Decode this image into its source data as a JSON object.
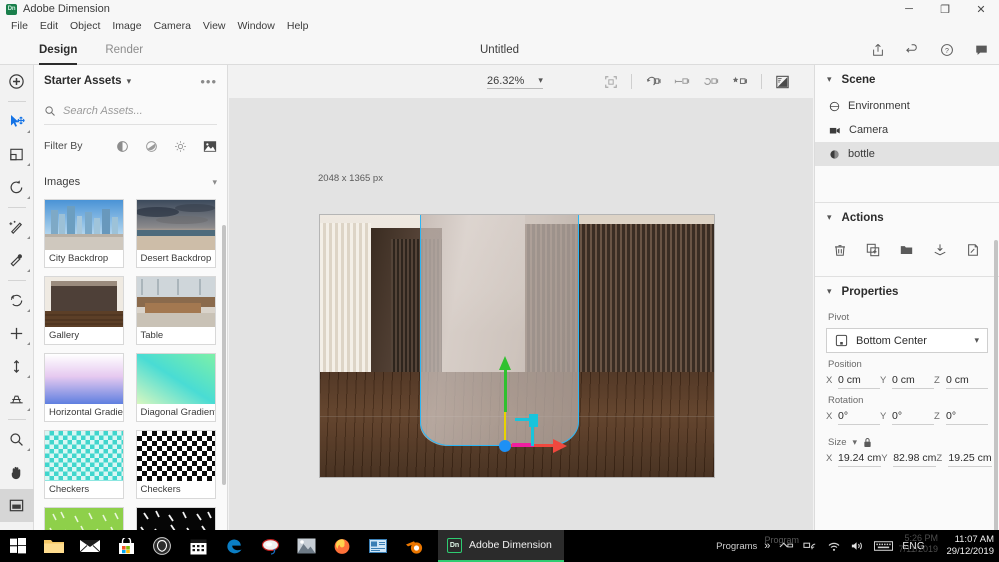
{
  "window": {
    "app_name": "Adobe Dimension",
    "app_badge": "Dn",
    "minimize": "─",
    "maximize": "❐",
    "close": "✕"
  },
  "menubar": {
    "items": [
      "File",
      "Edit",
      "Object",
      "Image",
      "Camera",
      "View",
      "Window",
      "Help"
    ]
  },
  "docbar": {
    "tabs": [
      {
        "label": "Design",
        "active": true
      },
      {
        "label": "Render",
        "active": false
      }
    ],
    "document_title": "Untitled",
    "actions": [
      "share-icon",
      "undo-icon",
      "help-icon",
      "comment-icon"
    ]
  },
  "toolrail": {
    "tools": [
      {
        "name": "add-content-icon",
        "selected": false
      },
      {
        "name": "select-move-icon",
        "selected": false
      },
      {
        "name": "magic-wand-place-icon",
        "selected": false
      },
      {
        "name": "rotate-icon",
        "selected": false
      },
      {
        "name": "material-picker-icon",
        "selected": false
      },
      {
        "name": "sampler-eyedropper-icon",
        "selected": false
      },
      {
        "name": "orbit-icon",
        "selected": false
      },
      {
        "name": "pan-move-icon",
        "selected": false
      },
      {
        "name": "dolly-icon",
        "selected": false
      },
      {
        "name": "horizon-icon",
        "selected": false
      },
      {
        "name": "zoom-icon",
        "selected": false
      },
      {
        "name": "hand-icon",
        "selected": false
      },
      {
        "name": "render-preview-icon",
        "selected": true
      }
    ]
  },
  "assets_panel": {
    "title": "Starter Assets",
    "overflow_label": "•••",
    "search_placeholder": "Search Assets...",
    "filter_label": "Filter By",
    "filter_icons": [
      "models-filter-icon",
      "materials-filter-icon",
      "lights-filter-icon",
      "images-filter-icon"
    ],
    "section_title": "Images",
    "cards": [
      {
        "label": "City Backdrop",
        "thumb": "city"
      },
      {
        "label": "Desert Backdrop",
        "thumb": "desert"
      },
      {
        "label": "Gallery",
        "thumb": "gallery"
      },
      {
        "label": "Table",
        "thumb": "table"
      },
      {
        "label": "Horizontal Gradient",
        "thumb": "hgrad"
      },
      {
        "label": "Diagonal Gradient",
        "thumb": "dgrad"
      },
      {
        "label": "Checkers",
        "thumb": "checker-teal"
      },
      {
        "label": "Checkers",
        "thumb": "checker-bw"
      },
      {
        "label": "",
        "thumb": "confetti-green"
      },
      {
        "label": "",
        "thumb": "confetti-black"
      }
    ]
  },
  "canvas": {
    "zoom_level": "26.32%",
    "camera_tools": [
      "fit-to-view-icon",
      "orbit-camera-icon",
      "pan-camera-icon",
      "dolly-camera-icon",
      "camera-bookmark-icon",
      "render-preview-quality-icon"
    ],
    "artboard_dimensions": "2048 x 1365 px"
  },
  "scene_panel": {
    "title": "Scene",
    "items": [
      {
        "label": "Environment",
        "icon": "environment-icon",
        "selected": false
      },
      {
        "label": "Camera",
        "icon": "camera-icon",
        "selected": false
      },
      {
        "label": "bottle",
        "icon": "model-icon",
        "selected": true
      }
    ]
  },
  "actions_panel": {
    "title": "Actions",
    "buttons": [
      "delete-icon",
      "duplicate-icon",
      "group-folder-icon",
      "place-on-ground-icon",
      "export-icon"
    ]
  },
  "properties_panel": {
    "title": "Properties",
    "pivot_label": "Pivot",
    "pivot_value": "Bottom Center",
    "position": {
      "label": "Position",
      "x_axis": "X",
      "x": "0 cm",
      "y_axis": "Y",
      "y": "0 cm",
      "z_axis": "Z",
      "z": "0 cm"
    },
    "rotation": {
      "label": "Rotation",
      "x_axis": "X",
      "x": "0°",
      "y_axis": "Y",
      "y": "0°",
      "z_axis": "Z",
      "z": "0°"
    },
    "size": {
      "label": "Size",
      "lock_icon": "lock-icon",
      "x_axis": "X",
      "x": "19.24 cm",
      "y_axis": "Y",
      "y": "82.98 cm",
      "z_axis": "Z",
      "z": "19.25 cm"
    }
  },
  "taskbar": {
    "start_icon": "windows-start-icon",
    "pinned": [
      "file-explorer-icon",
      "mail-icon",
      "microsoft-store-icon",
      "unreal-engine-icon",
      "calendar-icon",
      "edge-icon",
      "paint3d-icon",
      "photos-icon",
      "firefox-icon",
      "remote-desktop-icon",
      "blender-icon"
    ],
    "active_window": {
      "badge": "Dn",
      "label": "Adobe Dimension"
    },
    "tray": {
      "overflow_chevron": "»",
      "programs_label": "Programs",
      "programs_ghost": "Program",
      "icons": [
        "usb-eject-icon",
        "network-icon",
        "wifi-icon",
        "volume-icon",
        "keyboard-icon"
      ],
      "language": "ENG",
      "time": "11:07 AM",
      "date": "29/12/2019",
      "ghost_time": "5:26 PM",
      "ghost_date": "7/11/2019"
    }
  },
  "colors": {
    "accent_green": "#2ecc71",
    "selection_blue": "#29b6f6",
    "gizmo_x": "#f0483e",
    "gizmo_y": "#2fc12f",
    "gizmo_z": "#17c4dc",
    "gizmo_hub": "#1e90f5",
    "panel_bg": "#fafafa",
    "canvas_bg": "#e3e3e3"
  }
}
